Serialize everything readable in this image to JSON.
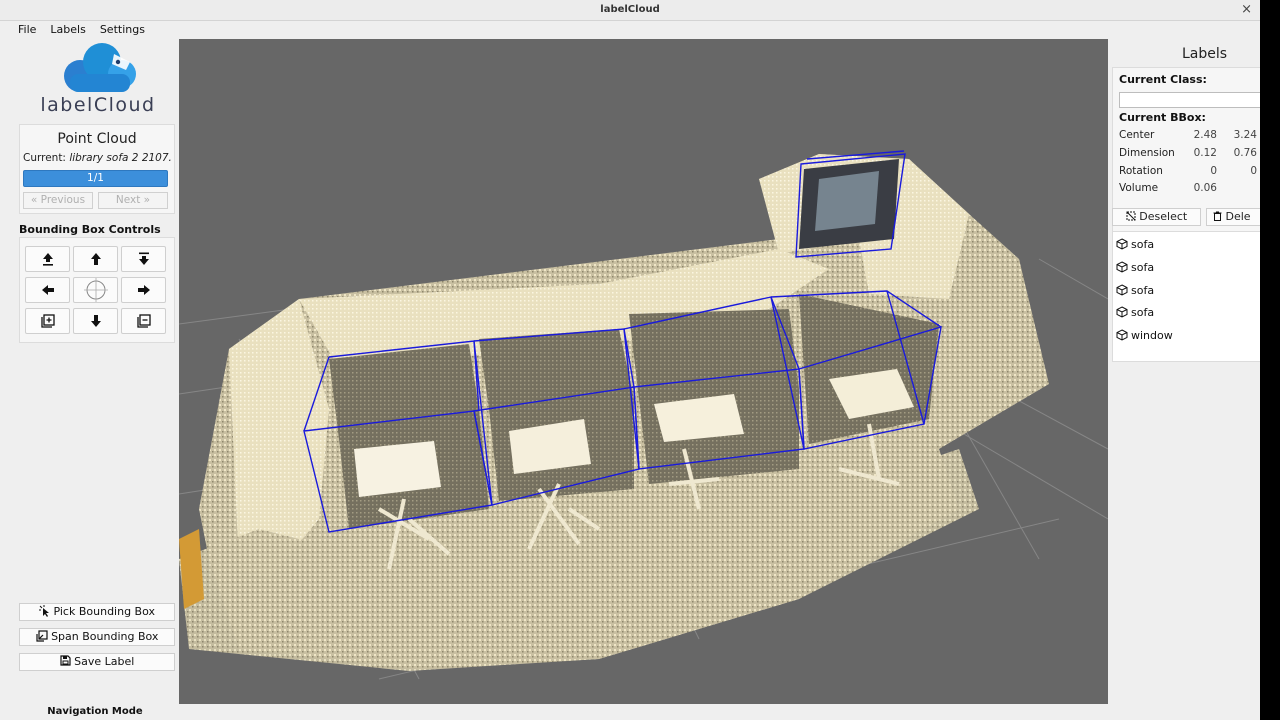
{
  "window": {
    "title": "labelCloud",
    "close_glyph": "×"
  },
  "menu": [
    "File",
    "Labels",
    "Settings"
  ],
  "logo": {
    "text": "labelCloud",
    "icon": "cloud-logo-icon"
  },
  "point_cloud": {
    "title": "Point Cloud",
    "current_prefix": "Current: ",
    "current_file": "library sofa 2 2107.",
    "progress_text": "1/1",
    "progress_value": 1.0,
    "previous_label": "« Previous",
    "next_label": "Next »"
  },
  "bbox_controls": {
    "title": "Bounding Box Controls",
    "buttons": [
      {
        "icon": "move-up-z-icon"
      },
      {
        "icon": "arrow-up-icon"
      },
      {
        "icon": "move-down-z-icon"
      },
      {
        "icon": "arrow-left-icon"
      },
      {
        "icon": "rotate-icon"
      },
      {
        "icon": "arrow-right-icon"
      },
      {
        "icon": "increase-icon"
      },
      {
        "icon": "arrow-down-icon"
      },
      {
        "icon": "decrease-icon"
      }
    ]
  },
  "actions": {
    "pick_label": "Pick Bounding Box",
    "span_label": "Span Bounding Box",
    "save_label": "Save Label"
  },
  "navigation_mode": "Navigation Mode",
  "labels_panel": {
    "title": "Labels",
    "current_class_label": "Current Class:",
    "current_class_value": "",
    "current_bbox_label": "Current BBox:",
    "rows": [
      {
        "key": "Center",
        "v1": "2.48",
        "v2": "3.24"
      },
      {
        "key": "Dimension",
        "v1": "0.12",
        "v2": "0.76"
      },
      {
        "key": "Rotation",
        "v1": "0",
        "v2": "0"
      },
      {
        "key": "Volume",
        "v1": "0.06",
        "v2": ""
      }
    ],
    "deselect_label": "Deselect",
    "delete_label": "Dele",
    "items": [
      "sofa",
      "sofa",
      "sofa",
      "sofa",
      "window"
    ]
  },
  "colors": {
    "viewport_bg": "#676767",
    "bbox_line": "#1a1adc",
    "progress": "#3c8fdb",
    "logo_blue": "#1f8fd6"
  }
}
